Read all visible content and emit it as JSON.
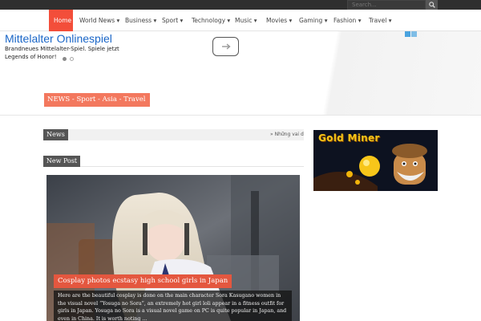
{
  "topbar": {
    "search_placeholder": "Search..."
  },
  "nav": {
    "items": [
      {
        "label": "Home",
        "active": true
      },
      {
        "label": "World News",
        "dropdown": true
      },
      {
        "label": "Business",
        "dropdown": true
      },
      {
        "label": "Sport",
        "dropdown": true
      },
      {
        "label": "Technology",
        "dropdown": true
      },
      {
        "label": "Music",
        "dropdown": true
      },
      {
        "label": "Movies",
        "dropdown": true
      },
      {
        "label": "Gaming",
        "dropdown": true
      },
      {
        "label": "Fashion",
        "dropdown": true
      },
      {
        "label": "Travel",
        "dropdown": true
      }
    ],
    "caret": "▾"
  },
  "header_ad": {
    "title": "Mittelalter Onlinespiel",
    "text": "Brandneues Mittelalter-Spiel. Spiele jetzt Legends of Honor!",
    "arrow_icon": "arrow-right-icon",
    "dots": 2
  },
  "site": {
    "tagline": "NEWS - Sport - Asia - Travel"
  },
  "ticker": {
    "label": "News",
    "text": "» Những vai d"
  },
  "section": {
    "label": "New Post"
  },
  "featured_post": {
    "title": "Cosplay photos ecstasy high school girls in Japan",
    "excerpt": "Here are the beautiful cosplay is done on the main character Sora Kasugano women in the visual novel “Yosuga no Sora”, an extremely hot girl loli appear in a fitness outfit for girls in Japan. Yosuga no Sora is a visual novel game on PC is quite popular in Japan, and even in China. It is worth noting ..."
  },
  "sidebar_ad": {
    "title": "Gold Miner"
  },
  "colors": {
    "accent": "#f34e3a",
    "tagline_bg": "#f3785e",
    "dark_label": "#555555",
    "ad_link": "#1a66c7"
  }
}
